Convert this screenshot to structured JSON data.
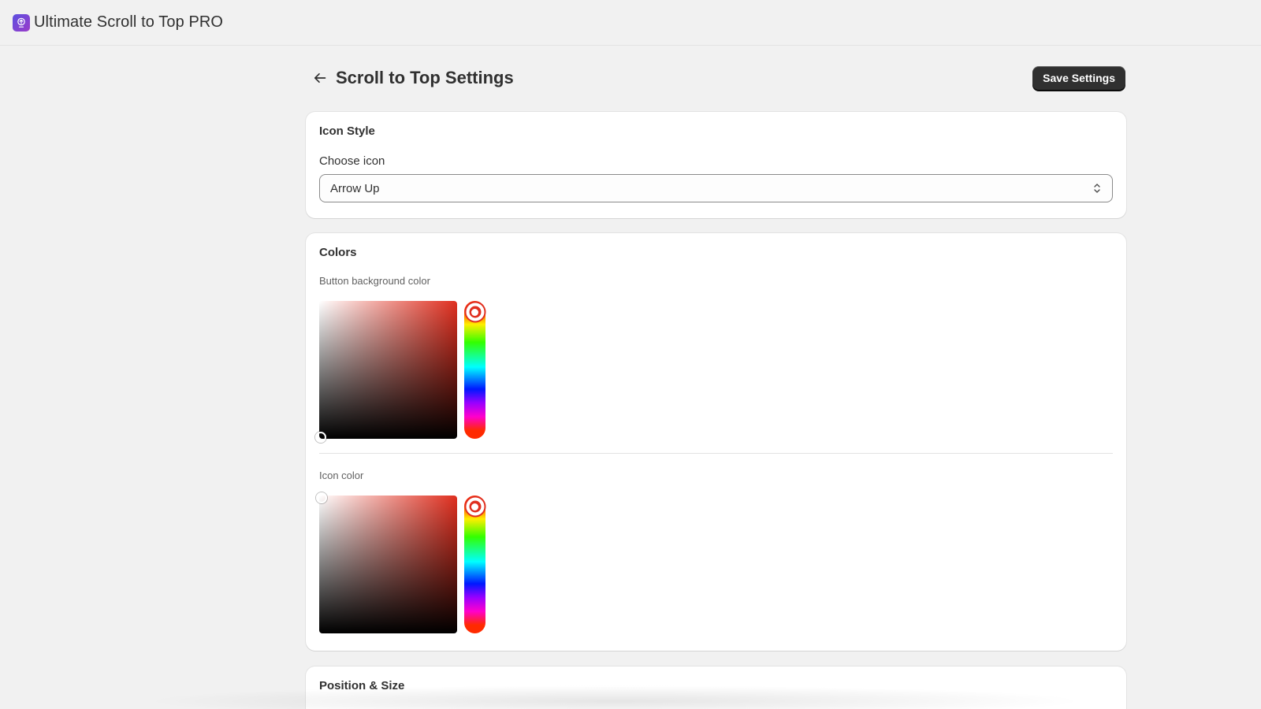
{
  "app": {
    "title": "Ultimate Scroll to Top PRO",
    "icon": "scroll-top-app-icon",
    "icon_gradient": [
      "#5b4fe0",
      "#9b3cc9"
    ]
  },
  "header": {
    "title": "Scroll to Top Settings",
    "back_icon": "arrow-left-icon",
    "save_label": "Save Settings"
  },
  "icon_style": {
    "title": "Icon Style",
    "choose_icon_label": "Choose icon",
    "choose_icon_value": "Arrow Up"
  },
  "colors": {
    "title": "Colors",
    "button_bg": {
      "label": "Button background color",
      "hue_color": "#e02f1f",
      "saturation": 0.0,
      "brightness": 0.0,
      "hue": 0
    },
    "icon_color": {
      "label": "Icon color",
      "hue_color": "#e02f1f",
      "saturation": 0.0,
      "brightness": 1.0,
      "hue": 0
    }
  },
  "position_size": {
    "title": "Position & Size"
  },
  "theme": {
    "background": "#f1f1f1",
    "card": "#ffffff",
    "primary_button": "#303030"
  }
}
